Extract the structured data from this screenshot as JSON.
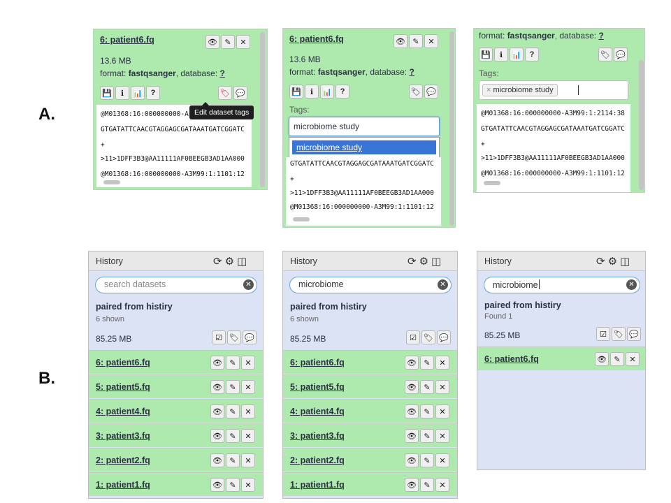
{
  "labels": {
    "a": "A.",
    "b": "B."
  },
  "dataset": {
    "title": "6: patient6.fq",
    "size": "13.6 MB",
    "format_label": "format:",
    "format_value": "fastqsanger",
    "database_label": ", database:",
    "database_value": "?",
    "tooltip": "Edit dataset tags",
    "tags_label": "Tags:",
    "tag_value": "microbiome study",
    "dropdown_option": "microbiome study",
    "peek_lines": [
      "@M01368:16:000000000-A3M99:1:2114:38",
      "GTGATATTCAACGTAGGAGCGATAAATGATCGGATC",
      "+",
      ">11>1DFF3B3@AA11111AF0BEEGB3AD1AA000",
      "@M01368:16:000000000-A3M99:1:1101:12"
    ],
    "peek_lines_tooltip": [
      "@M01368:16:000000000-A",
      "GTGATATTCAACGTAGGAGCGATAAATGATCGGATC",
      "+",
      ">11>1DFF3B3@AA11111AF0BEEGB3AD1AA000",
      "@M01368:16:000000000-A3M99:1:1101:12"
    ],
    "peek_lines_dropdown": [
      "GTGATATTCAACGTAGGAGCGATAAATGATCGGATC",
      "+",
      ">11>1DFF3B3@AA11111AF0BEEGB3AD1AA000",
      "@M01368:16:000000000-A3M99:1:1101:12"
    ],
    "icons": {
      "eye": "eye-icon",
      "pencil": "pencil-icon",
      "delete": "delete-icon",
      "save": "save-icon",
      "info": "info-icon",
      "chart": "chart-icon",
      "help": "help-icon",
      "tags": "tags-icon",
      "comment": "comment-icon"
    }
  },
  "history": {
    "header": "History",
    "search_placeholder": "search datasets",
    "search_query": "microbiome",
    "name": "paired from histiry",
    "shown": "6 shown",
    "found": "Found 1",
    "size": "85.25 MB",
    "items": [
      "6: patient6.fq",
      "5: patient5.fq",
      "4: patient4.fq",
      "3: patient3.fq",
      "2: patient2.fq",
      "1: patient1.fq"
    ],
    "filtered_items": [
      "6: patient6.fq"
    ],
    "colors": {
      "ok_green": "#aee9ae",
      "panel_blue": "#dce3f5",
      "select_blue": "#3875d7"
    }
  }
}
